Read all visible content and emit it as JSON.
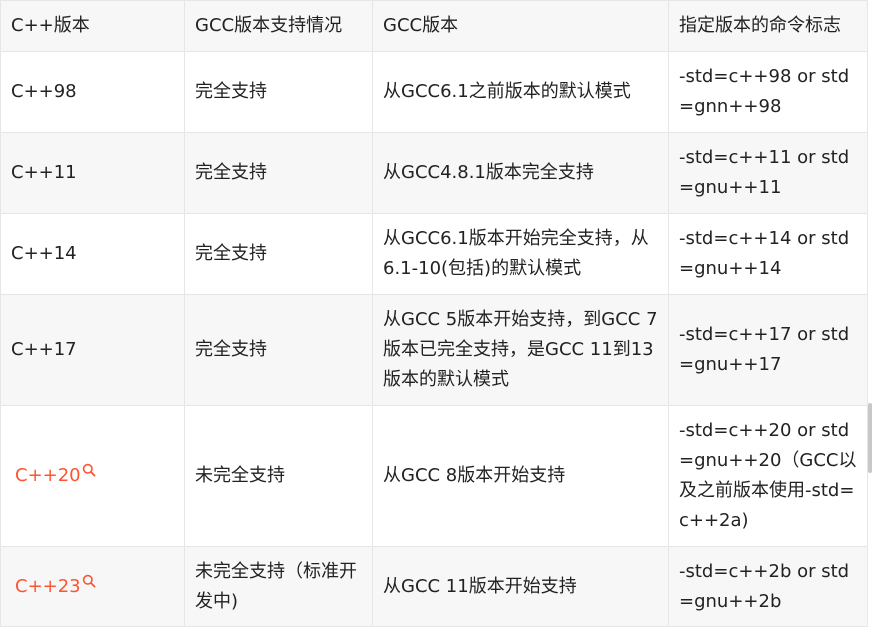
{
  "table": {
    "headers": [
      "C++版本",
      "GCC版本支持情况",
      "GCC版本",
      "指定版本的命令标志"
    ],
    "rows": [
      {
        "version": "C++98",
        "support": "完全支持",
        "gcc": "从GCC6.1之前版本的默认模式",
        "flag": "-std=c++98 or std=gnn++98",
        "linked": false
      },
      {
        "version": "C++11",
        "support": "完全支持",
        "gcc": "从GCC4.8.1版本完全支持",
        "flag": "-std=c++11 or std=gnu++11",
        "linked": false
      },
      {
        "version": "C++14",
        "support": "完全支持",
        "gcc": "从GCC6.1版本开始完全支持，从6.1-10(包括)的默认模式",
        "flag": "-std=c++14 or std=gnu++14",
        "linked": false
      },
      {
        "version": "C++17",
        "support": "完全支持",
        "gcc": "从GCC 5版本开始支持，到GCC 7版本已完全支持，是GCC 11到13版本的默认模式",
        "flag": "-std=c++17 or std=gnu++17",
        "linked": false
      },
      {
        "version": "C++20",
        "support": "未完全支持",
        "gcc": "从GCC 8版本开始支持",
        "flag": "-std=c++20 or std=gnu++20（GCC以及之前版本使用-std=c++2a)",
        "linked": true
      },
      {
        "version": "C++23",
        "support": "未完全支持（标准开发中)",
        "gcc": "从GCC 11版本开始支持",
        "flag": "-std=c++2b or std=gnu++2b",
        "linked": true
      }
    ]
  },
  "colors": {
    "link": "#fc5531",
    "border": "#e6e6e6",
    "stripe": "#f7f7f7",
    "text": "#222222"
  },
  "icons": {
    "link_icon": "search-icon"
  }
}
